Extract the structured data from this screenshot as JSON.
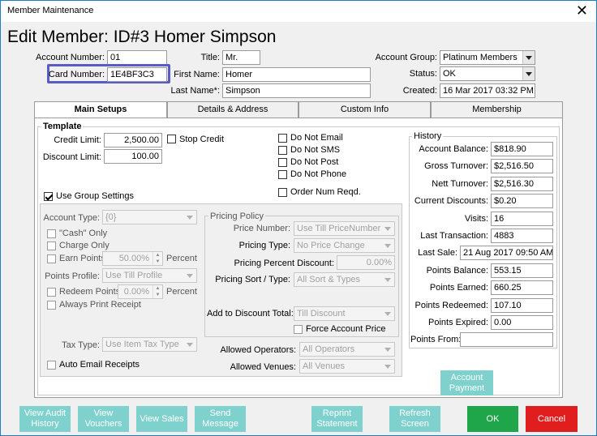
{
  "window": {
    "title": "Member Maintenance",
    "close": "✕"
  },
  "header": {
    "title": "Edit Member: ID#3 Homer Simpson"
  },
  "member": {
    "account_number_label": "Account Number:",
    "account_number": "01",
    "card_number_label": "Card Number:",
    "card_number": "1E4BF3C3",
    "title_label": "Title:",
    "title": "Mr.",
    "first_name_label": "First Name:",
    "first_name": "Homer",
    "last_name_label": "Last Name*:",
    "last_name": "Simpson",
    "account_group_label": "Account Group:",
    "account_group": "Platinum Members",
    "status_label": "Status:",
    "status": "OK",
    "created_label": "Created:",
    "created": "16 Mar 2017 03:32 PM"
  },
  "tabs": [
    "Main Setups",
    "Details & Address",
    "Custom Info",
    "Membership"
  ],
  "template": {
    "heading": "Template",
    "credit_limit_label": "Credit Limit:",
    "credit_limit": "2,500.00",
    "stop_credit": "Stop Credit",
    "discount_limit_label": "Discount Limit:",
    "discount_limit": "100.00",
    "do_not_email": "Do Not Email",
    "do_not_sms": "Do Not SMS",
    "do_not_post": "Do Not Post",
    "do_not_phone": "Do Not Phone",
    "order_num_reqd": "Order Num Reqd.",
    "use_group_settings": "Use Group Settings",
    "account_type_label": "Account Type:",
    "account_type": "{0}",
    "cash_only": "\"Cash\" Only",
    "charge_only": "Charge Only",
    "earn_points": "Earn Points",
    "earn_points_value": "50.00%",
    "percent": "Percent",
    "points_profile_label": "Points Profile:",
    "points_profile": "Use Till Profile",
    "redeem_points": "Redeem Points",
    "redeem_points_value": "0.00%",
    "always_print_receipt": "Always Print Receipt",
    "tax_type_label": "Tax Type:",
    "tax_type": "Use Item Tax Type",
    "auto_email_receipts": "Auto Email Receipts"
  },
  "pricing": {
    "heading": "Pricing Policy",
    "price_number_label": "Price Number:",
    "price_number": "Use Till PriceNumber",
    "pricing_type_label": "Pricing Type:",
    "pricing_type": "No Price Change",
    "pricing_percent_label": "Pricing Percent Discount:",
    "pricing_percent": "0.00%",
    "pricing_sort_label": "Pricing Sort / Type:",
    "pricing_sort": "All Sort & Types",
    "add_discount_label": "Add to Discount Total:",
    "add_discount": "Till Discount",
    "force_account_price": "Force Account Price",
    "allowed_operators_label": "Allowed Operators:",
    "allowed_operators": "All Operators",
    "allowed_venues_label": "Allowed Venues:",
    "allowed_venues": "All Venues"
  },
  "history": {
    "heading": "History",
    "rows": [
      {
        "label": "Account Balance:",
        "value": "$818.90"
      },
      {
        "label": "Gross Turnover:",
        "value": "$2,516.50"
      },
      {
        "label": "Nett Turnover:",
        "value": "$2,516.30"
      },
      {
        "label": "Current Discounts:",
        "value": "$0.20"
      },
      {
        "label": "Visits:",
        "value": "16"
      },
      {
        "label": "Last Transaction:",
        "value": "4883"
      },
      {
        "label": "Last Sale:",
        "value": "21 Aug 2017 09:50 AM"
      },
      {
        "label": "Points Balance:",
        "value": "553.15"
      },
      {
        "label": "Points Earned:",
        "value": "660.25"
      },
      {
        "label": "Points Redeemed:",
        "value": "107.10"
      },
      {
        "label": "Points Expired:",
        "value": "0.00"
      },
      {
        "label": "Points From:",
        "value": ""
      }
    ]
  },
  "buttons": {
    "account_payment": [
      "Account",
      "Payment"
    ],
    "view_audit": [
      "View Audit",
      "History"
    ],
    "view_vouchers": [
      "View",
      "Vouchers"
    ],
    "view_sales": "View Sales",
    "send_message": [
      "Send",
      "Message"
    ],
    "reprint": [
      "Reprint",
      "Statement"
    ],
    "refresh": [
      "Refresh",
      "Screen"
    ],
    "ok": "OK",
    "cancel": "Cancel"
  },
  "colors": {
    "teal_button": "#7fd1cd",
    "ok": "#1fa64a",
    "cancel": "#e01e1e",
    "highlight": "#5b5bc8"
  }
}
